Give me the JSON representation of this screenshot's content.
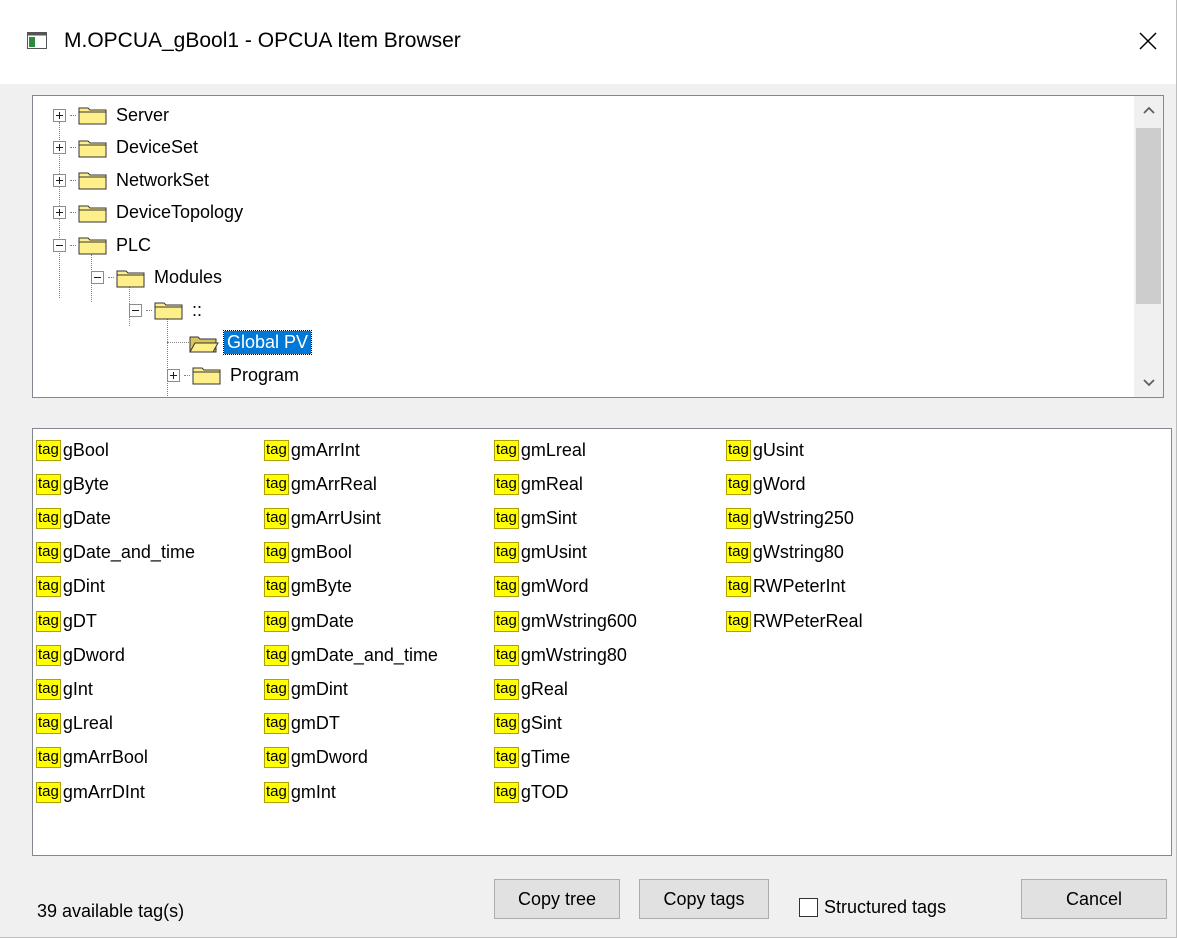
{
  "window": {
    "title": "M.OPCUA_gBool1 - OPCUA Item Browser",
    "close_glyph": "✕"
  },
  "tree": {
    "nodes": [
      {
        "label": "Server",
        "expander": "plus",
        "selected": false
      },
      {
        "label": "DeviceSet",
        "expander": "plus",
        "selected": false
      },
      {
        "label": "NetworkSet",
        "expander": "plus",
        "selected": false
      },
      {
        "label": "DeviceTopology",
        "expander": "plus",
        "selected": false
      },
      {
        "label": "PLC",
        "expander": "minus",
        "selected": false
      },
      {
        "label": "Modules",
        "expander": "minus",
        "selected": false
      },
      {
        "label": "::",
        "expander": "minus",
        "selected": false
      },
      {
        "label": "Global PV",
        "expander": "none",
        "selected": true
      },
      {
        "label": "Program",
        "expander": "plus",
        "selected": false
      }
    ],
    "scroll_up_glyph": "^",
    "scroll_down_glyph": "v"
  },
  "tags": {
    "icon_text": "tag",
    "columns": [
      [
        "gBool",
        "gByte",
        "gDate",
        "gDate_and_time",
        "gDint",
        "gDT",
        "gDword",
        "gInt",
        "gLreal",
        "gmArrBool",
        "gmArrDInt"
      ],
      [
        "gmArrInt",
        "gmArrReal",
        "gmArrUsint",
        "gmBool",
        "gmByte",
        "gmDate",
        "gmDate_and_time",
        "gmDint",
        "gmDT",
        "gmDword",
        "gmInt"
      ],
      [
        "gmLreal",
        "gmReal",
        "gmSint",
        "gmUsint",
        "gmWord",
        "gmWstring600",
        "gmWstring80",
        "gReal",
        "gSint",
        "gTime",
        "gTOD"
      ],
      [
        "gUsint",
        "gWord",
        "gWstring250",
        "gWstring80",
        "RWPeterInt",
        "RWPeterReal"
      ]
    ]
  },
  "footer": {
    "status_text": "39 available tag(s)",
    "copy_tree_label": "Copy tree",
    "copy_tags_label": "Copy tags",
    "structured_tags_label": "Structured tags",
    "structured_tags_checked": false,
    "cancel_label": "Cancel"
  },
  "colors": {
    "selection": "#0078d7",
    "tag_icon_bg": "#ffff00",
    "folder_fill": "#ffef8a"
  }
}
